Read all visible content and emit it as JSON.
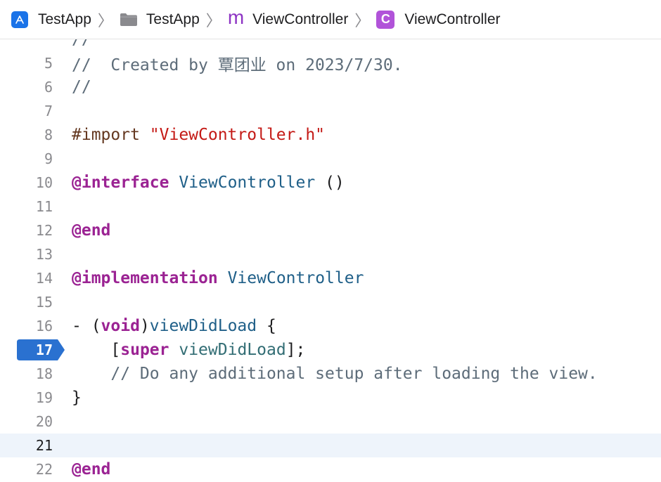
{
  "jumpbar": {
    "items": [
      {
        "label": "TestApp",
        "icon": "app-icon"
      },
      {
        "label": "TestApp",
        "icon": "folder-icon"
      },
      {
        "label": "ViewController",
        "icon": "objc-implementation-icon",
        "icon_glyph": "m"
      },
      {
        "label": "ViewController",
        "icon": "class-icon",
        "icon_glyph": "C"
      }
    ],
    "separator": "〉"
  },
  "editor": {
    "current_line": 21,
    "breakpoint_line": 17,
    "lines": [
      {
        "num": "",
        "tokens": [
          {
            "t": "comment",
            "s": "//"
          }
        ]
      },
      {
        "num": "5",
        "tokens": [
          {
            "t": "comment",
            "s": "//  Created by 覃团业 on 2023/7/30."
          }
        ]
      },
      {
        "num": "6",
        "tokens": [
          {
            "t": "comment",
            "s": "//"
          }
        ]
      },
      {
        "num": "7",
        "tokens": []
      },
      {
        "num": "8",
        "tokens": [
          {
            "t": "preproc",
            "s": "#import "
          },
          {
            "t": "string",
            "s": "\"ViewController.h\""
          }
        ]
      },
      {
        "num": "9",
        "tokens": []
      },
      {
        "num": "10",
        "tokens": [
          {
            "t": "keyword",
            "s": "@interface"
          },
          {
            "t": "plain",
            "s": " "
          },
          {
            "t": "class",
            "s": "ViewController"
          },
          {
            "t": "plain",
            "s": " ()"
          }
        ]
      },
      {
        "num": "11",
        "tokens": []
      },
      {
        "num": "12",
        "tokens": [
          {
            "t": "keyword",
            "s": "@end"
          }
        ]
      },
      {
        "num": "13",
        "tokens": []
      },
      {
        "num": "14",
        "tokens": [
          {
            "t": "keyword",
            "s": "@implementation"
          },
          {
            "t": "plain",
            "s": " "
          },
          {
            "t": "class",
            "s": "ViewController"
          }
        ]
      },
      {
        "num": "15",
        "tokens": []
      },
      {
        "num": "16",
        "tokens": [
          {
            "t": "plain",
            "s": "- ("
          },
          {
            "t": "keyword-light",
            "s": "void"
          },
          {
            "t": "plain",
            "s": ")"
          },
          {
            "t": "class",
            "s": "viewDidLoad"
          },
          {
            "t": "plain",
            "s": " {"
          }
        ]
      },
      {
        "num": "17",
        "tokens": [
          {
            "t": "plain",
            "s": "    ["
          },
          {
            "t": "keyword",
            "s": "super"
          },
          {
            "t": "plain",
            "s": " "
          },
          {
            "t": "method",
            "s": "viewDidLoad"
          },
          {
            "t": "plain",
            "s": "];"
          }
        ]
      },
      {
        "num": "18",
        "tokens": [
          {
            "t": "comment",
            "s": "    // Do any additional setup after loading the view."
          }
        ]
      },
      {
        "num": "19",
        "tokens": [
          {
            "t": "plain",
            "s": "}"
          }
        ]
      },
      {
        "num": "20",
        "tokens": []
      },
      {
        "num": "21",
        "tokens": []
      },
      {
        "num": "22",
        "tokens": [
          {
            "t": "keyword",
            "s": "@end"
          }
        ]
      }
    ]
  },
  "colors": {
    "breakpoint": "#2a71d0",
    "current_line_bg": "#eef4fb",
    "keyword": "#9b2393",
    "string": "#c41a16",
    "comment": "#5d6c79",
    "class": "#1f5f88"
  }
}
